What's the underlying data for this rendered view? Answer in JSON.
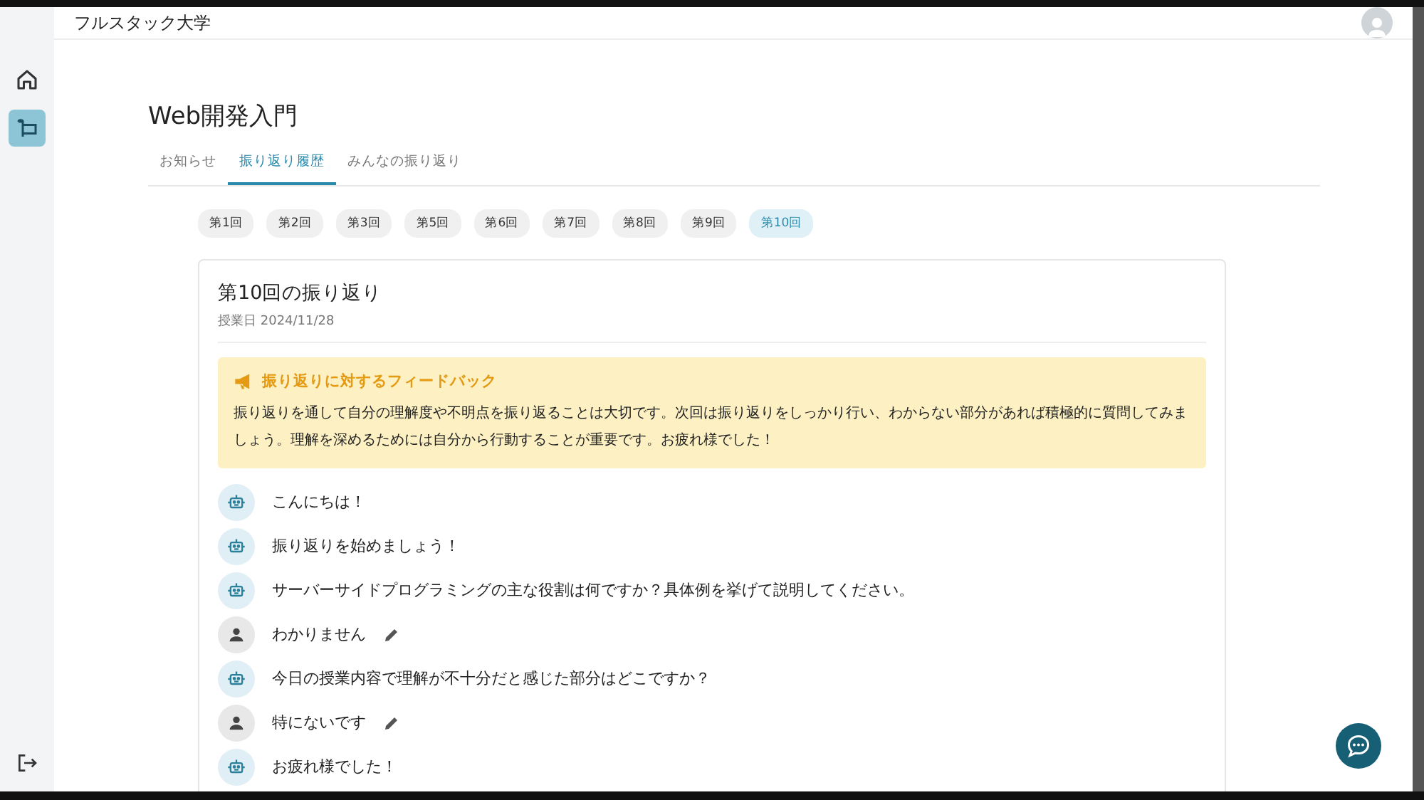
{
  "header": {
    "title": "フルスタック大学"
  },
  "sidebar": {
    "items": [
      {
        "kind": "home",
        "selected": false
      },
      {
        "kind": "reflection",
        "selected": true
      }
    ]
  },
  "course": {
    "title": "Web開発入門",
    "tabs": [
      {
        "label": "お知らせ",
        "selected": false
      },
      {
        "label": "振り返り履歴",
        "selected": true
      },
      {
        "label": "みんなの振り返り",
        "selected": false
      }
    ]
  },
  "sessions": [
    {
      "label": "第1回",
      "selected": false
    },
    {
      "label": "第2回",
      "selected": false
    },
    {
      "label": "第3回",
      "selected": false
    },
    {
      "label": "第5回",
      "selected": false
    },
    {
      "label": "第6回",
      "selected": false
    },
    {
      "label": "第7回",
      "selected": false
    },
    {
      "label": "第8回",
      "selected": false
    },
    {
      "label": "第9回",
      "selected": false
    },
    {
      "label": "第10回",
      "selected": true
    }
  ],
  "reflection": {
    "title": "第10回の振り返り",
    "date": "授業日 2024/11/28",
    "feedback": {
      "title": "振り返りに対するフィードバック",
      "body": "振り返りを通して自分の理解度や不明点を振り返ることは大切です。次回は振り返りをしっかり行い、わからない部分があれば積極的に質問してみましょう。理解を深めるためには自分から行動することが重要です。お疲れ様でした！"
    },
    "messages": [
      {
        "kind": "bot",
        "text": "こんにちは！"
      },
      {
        "kind": "bot",
        "text": "振り返りを始めましょう！"
      },
      {
        "kind": "bot",
        "text": "サーバーサイドプログラミングの主な役割は何ですか？具体例を挙げて説明してください。"
      },
      {
        "kind": "user",
        "text": "わかりません"
      },
      {
        "kind": "bot",
        "text": "今日の授業内容で理解が不十分だと感じた部分はどこですか？"
      },
      {
        "kind": "user",
        "text": "特にないです"
      },
      {
        "kind": "bot",
        "text": "お疲れ様でした！"
      }
    ]
  }
}
